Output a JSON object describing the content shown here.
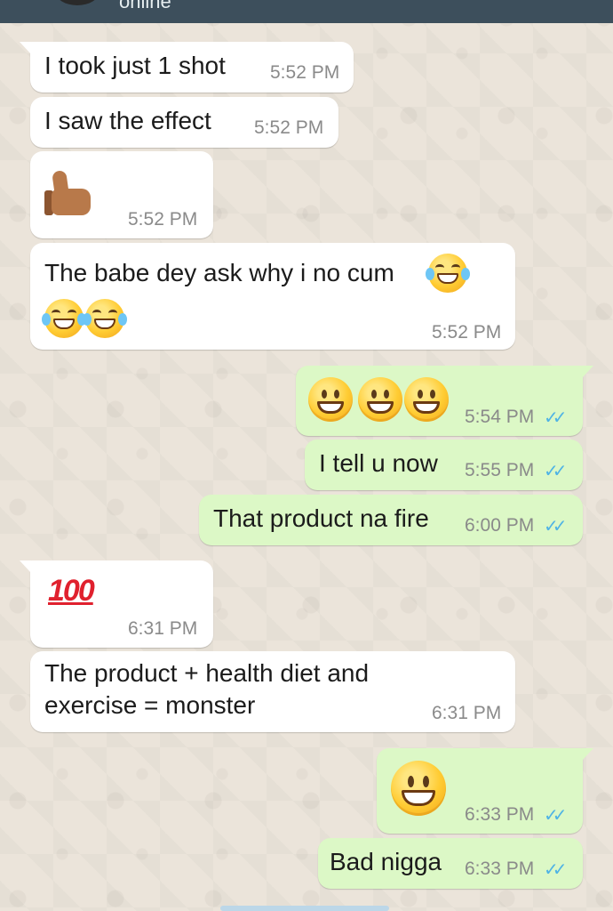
{
  "header": {
    "status": "online"
  },
  "messages": [
    {
      "text": "I took just 1 shot",
      "time": "5:52 PM"
    },
    {
      "text": "I saw the effect",
      "time": "5:52 PM"
    },
    {
      "emoji": "thumbs-up",
      "time": "5:52 PM"
    },
    {
      "text": "The babe dey ask why i no cum",
      "time": "5:52 PM"
    },
    {
      "time": "5:54 PM"
    },
    {
      "text": "I tell u now",
      "time": "5:55 PM"
    },
    {
      "text": "That product na fire",
      "time": "6:00 PM"
    },
    {
      "emoji_text": "100",
      "time": "6:31 PM"
    },
    {
      "text": "The product + health diet and exercise = monster",
      "time": "6:31 PM"
    },
    {
      "time": "6:33 PM"
    },
    {
      "text": "Bad nigga",
      "time": "6:33 PM"
    }
  ],
  "colors": {
    "incoming": "#ffffff",
    "outgoing": "#dcf8c6",
    "read_ticks": "#4fb3e5",
    "header": "#3d4f5c"
  },
  "icons": {
    "read_receipt": "double-check-icon"
  }
}
